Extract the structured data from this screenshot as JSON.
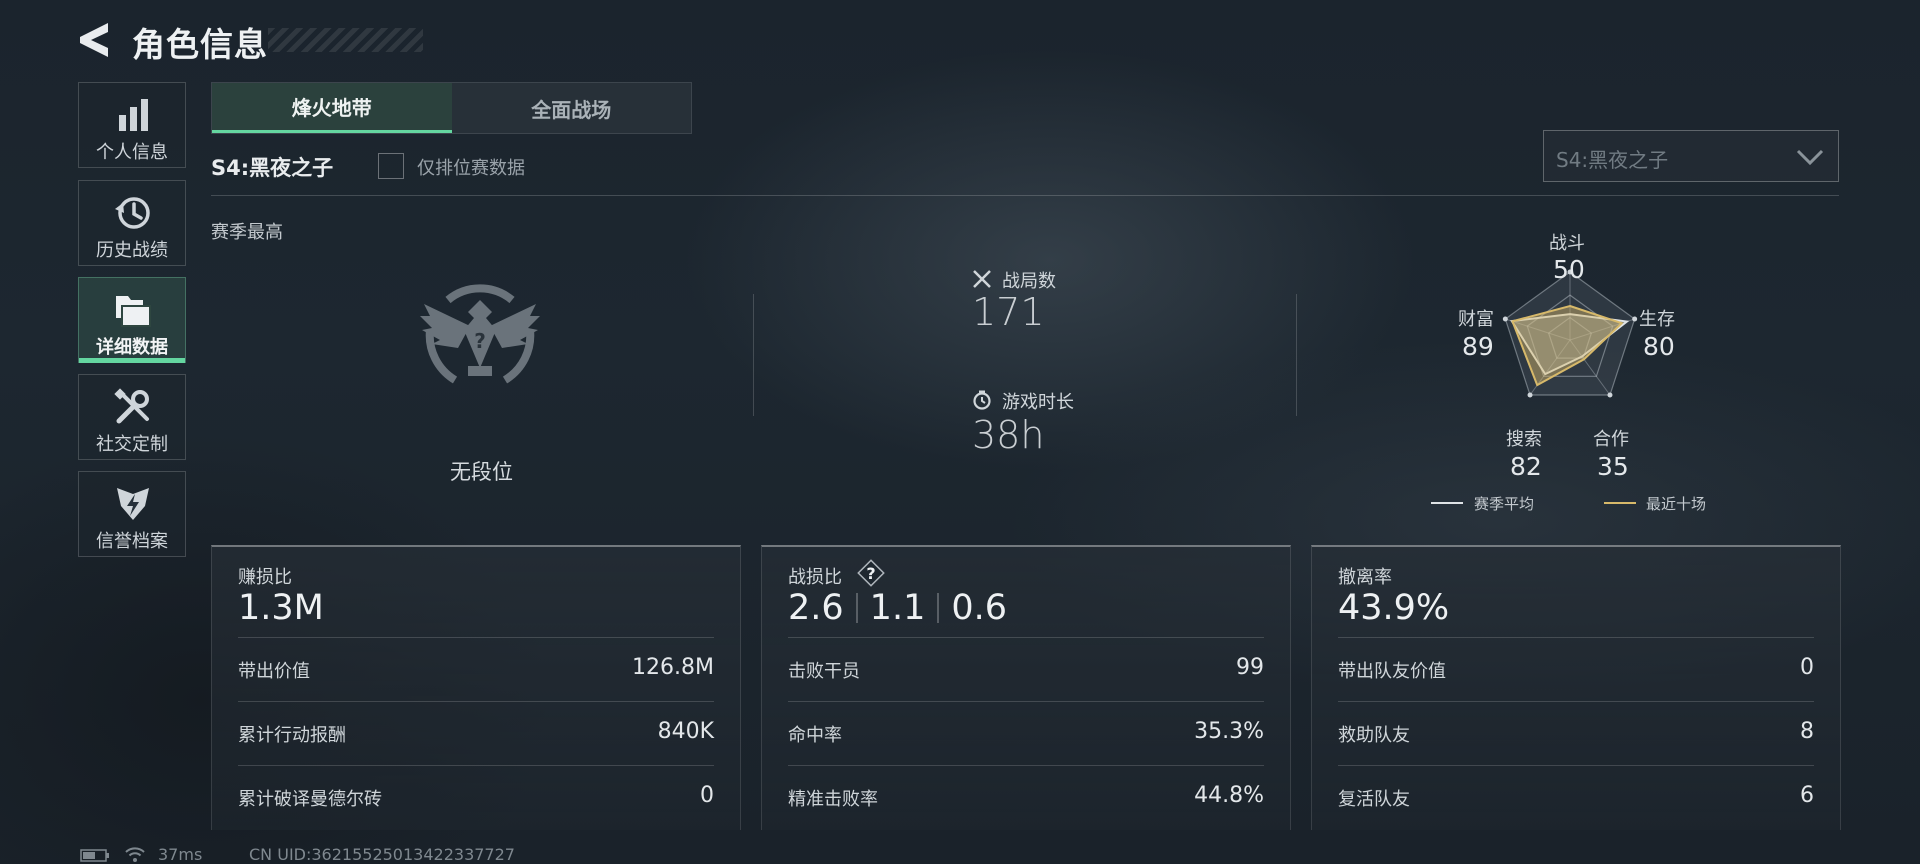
{
  "header": {
    "title": "角色信息"
  },
  "sidebar": {
    "items": [
      {
        "label": "个人信息",
        "icon": "bar-chart-icon"
      },
      {
        "label": "历史战绩",
        "icon": "history-clock-icon"
      },
      {
        "label": "详细数据",
        "icon": "folders-icon",
        "active": true
      },
      {
        "label": "社交定制",
        "icon": "tools-icon"
      },
      {
        "label": "信誉档案",
        "icon": "shield-bolt-icon"
      }
    ]
  },
  "tabs": [
    {
      "label": "烽火地带",
      "active": true
    },
    {
      "label": "全面战场",
      "active": false
    }
  ],
  "season": {
    "name": "S4:黑夜之子",
    "ranked_only_label": "仅排位赛数据",
    "ranked_only_checked": false,
    "select_value": "S4:黑夜之子"
  },
  "season_best": {
    "label": "赛季最高",
    "rank_name": "无段位"
  },
  "overview": {
    "matches": {
      "label": "战局数",
      "value": "171"
    },
    "playtime": {
      "label": "游戏时长",
      "value": "38h"
    }
  },
  "radar": {
    "labels": [
      {
        "name": "战斗",
        "value": "50"
      },
      {
        "name": "生存",
        "value": "80"
      },
      {
        "name": "合作",
        "value": "35"
      },
      {
        "name": "搜索",
        "value": "82"
      },
      {
        "name": "财富",
        "value": "89"
      }
    ],
    "series": [
      {
        "name": "赛季平均",
        "color": "#dfe3e6",
        "values": [
          38,
          88,
          30,
          62,
          90
        ]
      },
      {
        "name": "最近十场",
        "color": "#d7b96a",
        "values": [
          50,
          80,
          35,
          82,
          89
        ]
      }
    ],
    "max": 100
  },
  "cards": [
    {
      "head": "赚损比",
      "big": "1.3M",
      "rows": [
        {
          "label": "带出价值",
          "value": "126.8M"
        },
        {
          "label": "累计行动报酬",
          "value": "840K"
        },
        {
          "label": "累计破译曼德尔砖",
          "value": "0"
        }
      ]
    },
    {
      "head": "战损比",
      "big_parts": [
        "2.6",
        "1.1",
        "0.6"
      ],
      "rows": [
        {
          "label": "击败干员",
          "value": "99"
        },
        {
          "label": "命中率",
          "value": "35.3%"
        },
        {
          "label": "精准击败率",
          "value": "44.8%"
        }
      ]
    },
    {
      "head": "撤离率",
      "big": "43.9%",
      "rows": [
        {
          "label": "带出队友价值",
          "value": "0"
        },
        {
          "label": "救助队友",
          "value": "8"
        },
        {
          "label": "复活队友",
          "value": "6"
        }
      ]
    }
  ],
  "status_bar": {
    "ping": "37ms",
    "uid": "CN UID:36215525013422337727"
  },
  "colors": {
    "accent": "#64d6a0",
    "radar_recent": "#d7b96a",
    "radar_avg": "#dfe3e6"
  }
}
